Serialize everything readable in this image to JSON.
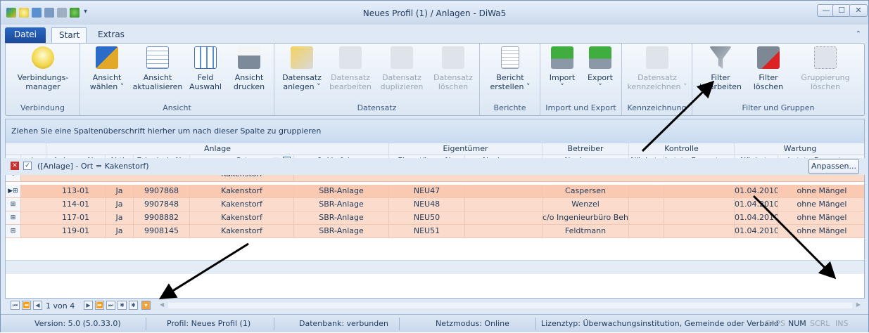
{
  "window": {
    "title": "Neues Profil (1) / Anlagen - DiWa5",
    "minimize": "—",
    "maximize": "☐",
    "close": "✕"
  },
  "tabs": [
    {
      "label": "Datei"
    },
    {
      "label": "Start"
    },
    {
      "label": "Extras"
    }
  ],
  "ribbon": {
    "groups": [
      {
        "label": "Verbindung",
        "buttons": [
          {
            "label": "Verbindungs-\nmanager",
            "icon": "lightbulb-icon"
          }
        ]
      },
      {
        "label": "Ansicht",
        "buttons": [
          {
            "label": "Ansicht\nwählen ˅",
            "icon": "cubes-icon"
          },
          {
            "label": "Ansicht\naktualisieren",
            "icon": "table-refresh-icon"
          },
          {
            "label": "Feld\nAuswahl",
            "icon": "table-check-icon"
          },
          {
            "label": "Ansicht\ndrucken",
            "icon": "printer-icon"
          }
        ]
      },
      {
        "label": "Datensatz",
        "buttons": [
          {
            "label": "Datensatz\nanlegen ˅",
            "icon": "record-new-icon"
          },
          {
            "label": "Datensatz\nbearbeiten",
            "icon": "record-edit-icon",
            "disabled": true
          },
          {
            "label": "Datensatz\nduplizieren",
            "icon": "record-copy-icon",
            "disabled": true
          },
          {
            "label": "Datensatz\nlöschen",
            "icon": "record-delete-icon",
            "disabled": true
          }
        ]
      },
      {
        "label": "Berichte",
        "buttons": [
          {
            "label": "Bericht\nerstellen ˅",
            "icon": "report-icon"
          }
        ]
      },
      {
        "label": "Import und Export",
        "buttons": [
          {
            "label": "Import\n˅",
            "icon": "import-icon"
          },
          {
            "label": "Export\n˅",
            "icon": "export-icon"
          }
        ]
      },
      {
        "label": "Kennzeichnung",
        "buttons": [
          {
            "label": "Datensatz\nkennzeichnen ˅",
            "icon": "marker-icon",
            "disabled": true
          }
        ]
      },
      {
        "label": "Filter und Gruppen",
        "buttons": [
          {
            "label": "Filter\nbearbeiten",
            "icon": "filter-edit-icon"
          },
          {
            "label": "Filter\nlöschen",
            "icon": "filter-delete-icon"
          },
          {
            "label": "Gruppierung\nlöschen",
            "icon": "group-delete-icon",
            "disabled": true
          }
        ]
      }
    ]
  },
  "grid": {
    "group_hint": "Ziehen Sie eine Spaltenüberschrift hierher um nach dieser Spalte zu gruppieren",
    "bands": [
      "Anlage",
      "Eigentümer",
      "Betreiber",
      "Kontrolle",
      "Wartung"
    ],
    "columns": [
      "Anlagen-Nr.",
      "Aktiv",
      "Erlaubnis-Nr.",
      "Ort",
      "1. Verfahren",
      "Eigentümer-Nr.",
      "Nachname",
      "Nachname",
      "Nächste",
      "Letzte Bewertung",
      "Nächste",
      "Letzte Bewertung"
    ],
    "filter_value": "Kakenstorf",
    "rows": [
      [
        "113-01",
        "Ja",
        "9907868",
        "Kakenstorf",
        "SBR-Anlage",
        "NEU47",
        "",
        "Caspersen",
        "",
        "",
        "01.04.2010",
        "ohne Mängel"
      ],
      [
        "114-01",
        "Ja",
        "9907848",
        "Kakenstorf",
        "SBR-Anlage",
        "NEU48",
        "",
        "Wenzel",
        "",
        "",
        "01.04.2010",
        "ohne Mängel"
      ],
      [
        "117-01",
        "Ja",
        "9908882",
        "Kakenstorf",
        "SBR-Anlage",
        "NEU50",
        "",
        "c/o Ingenieurbüro Behre",
        "",
        "",
        "01.04.2010",
        "ohne Mängel"
      ],
      [
        "119-01",
        "Ja",
        "9908145",
        "Kakenstorf",
        "SBR-Anlage",
        "NEU51",
        "",
        "Feldtmann",
        "",
        "",
        "01.04.2010",
        "ohne Mängel"
      ]
    ]
  },
  "filterbar": {
    "expression": "([Anlage] - Ort = Kakenstorf)",
    "customize": "Anpassen..."
  },
  "navigator": {
    "position": "1 von 4"
  },
  "statusbar": {
    "version": "Version: 5.0 (5.0.33.0)",
    "profile": "Profil: Neues Profil (1)",
    "database": "Datenbank: verbunden",
    "netmode": "Netzmodus: Online",
    "license": "Lizenztyp: Überwachungsinstitution, Gemeinde oder Verband",
    "caps": "CAPS",
    "num": "NUM",
    "scrl": "SCRL",
    "ins": "INS"
  },
  "colors": {
    "accent": "#2b66c2",
    "row_highlight": "#fbdccc",
    "filter_row": "#f9d9c8"
  }
}
